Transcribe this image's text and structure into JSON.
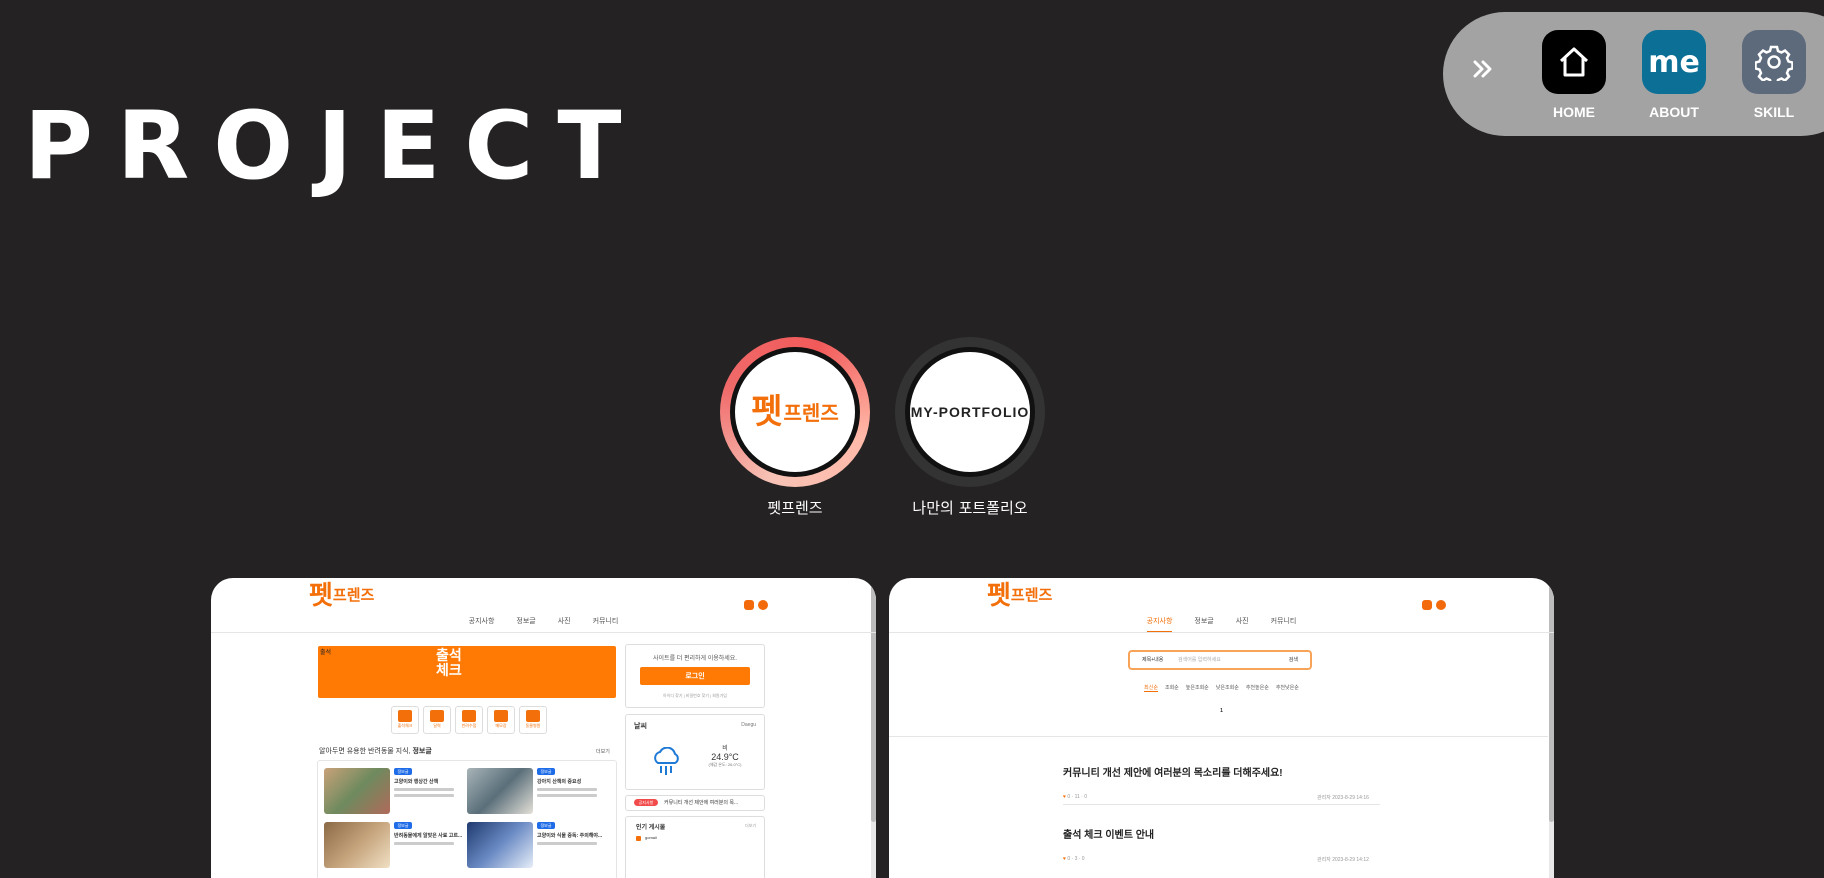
{
  "page": {
    "title": "PROJECT"
  },
  "nav": {
    "items": [
      {
        "label": "HOME",
        "icon": "home-icon",
        "bg": "#000000"
      },
      {
        "label": "ABOUT",
        "icon": "me-icon",
        "icon_text": "me",
        "bg": "#0b6f96"
      },
      {
        "label": "SKILL",
        "icon": "gear-icon",
        "bg": "#5c6a7c"
      }
    ]
  },
  "projects": [
    {
      "label": "펫프렌즈",
      "logo_big": "펫",
      "logo_small": "프렌즈",
      "active": true
    },
    {
      "label": "나만의 포트폴리오",
      "logo_text": "MY-PORTFOLIO",
      "active": false
    }
  ],
  "preview1": {
    "logo_big": "펫",
    "logo_small": "프렌즈",
    "menu": [
      "공지사항",
      "정보글",
      "사진",
      "커뮤니티"
    ],
    "banner_corner": "출석",
    "banner_line1": "출석",
    "banner_line2": "체크",
    "quick_labels": [
      "출석체크",
      "달력",
      "반려수첩",
      "메모장",
      "동물병원"
    ],
    "login_prompt": "사이트를 더 편리하게 이용하세요.",
    "login_button": "로그인",
    "login_links": "아이디 찾기 | 비밀번호 찾기 | 회원가입",
    "weather_title": "날씨",
    "weather_city": "Daegu",
    "weather_desc": "비",
    "weather_temp": "24.9°C",
    "weather_feel": "(체감 온도: 26.0°C)",
    "notice_badge": "공지사항",
    "notice_text": "커뮤니티 개선 제안에 여러분의 목...",
    "popular_title": "인기 게시물",
    "popular_more": "더보기",
    "popular_user": "gomail",
    "info_heading": "알아두면 유용한 반려동물 지식,",
    "info_heading_bold": "정보글",
    "info_more": "더보기",
    "post_tag": "정보글",
    "posts": [
      "고양이와 행상간 산책",
      "강아지 산책의 중요성",
      "반려동물에게 알맞은 사료 고르...",
      "고양이와 식물 중독: 주의해야..."
    ]
  },
  "preview2": {
    "logo_big": "펫",
    "logo_small": "프렌즈",
    "menu": [
      "공지사항",
      "정보글",
      "사진",
      "커뮤니티"
    ],
    "search_select": "제목+내용",
    "search_placeholder": "검색어를 입력하세요",
    "search_button": "검색",
    "tabs": [
      "최신순",
      "조회순",
      "높은조회순",
      "낮은조회순",
      "추천높은순",
      "추천낮은순"
    ],
    "page_num": "1",
    "notices": [
      {
        "title": "커뮤니티 개선 제안에 여러분의 목소리를 더해주세요!",
        "stats": "0 · 11 · 0",
        "author": "관리자",
        "date": "2023-8-29 14:16"
      },
      {
        "title": "출석 체크 이벤트 안내",
        "stats": "0 · 3 · 0",
        "author": "관리자",
        "date": "2023-8-29 14:12"
      }
    ]
  }
}
